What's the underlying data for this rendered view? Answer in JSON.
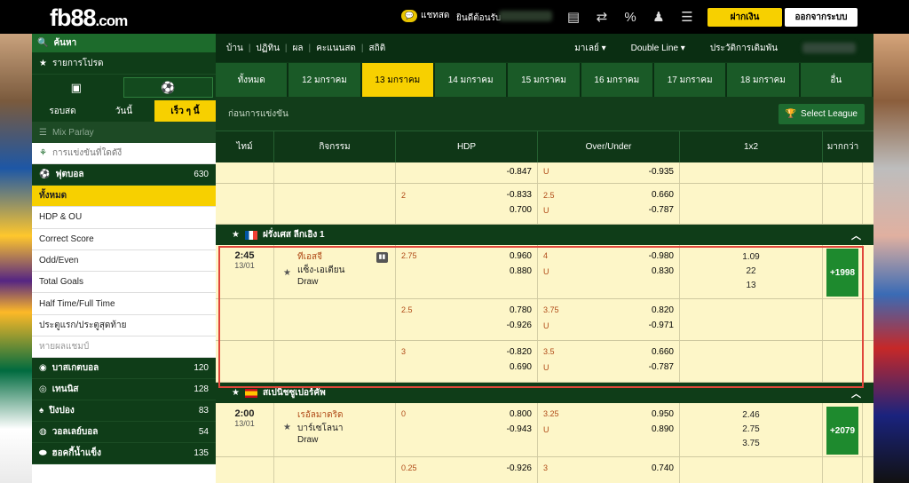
{
  "header": {
    "logo_main": "fb88",
    "logo_tld": ".com",
    "chat_label": "แชทสด",
    "welcome": "ยินดีต้อนรับ",
    "deposit": "ฝากเงิน",
    "logout": "ออกจากระบบ",
    "icons": [
      "bank-icon",
      "transfer-icon",
      "bonus-icon",
      "user-icon",
      "list-icon"
    ]
  },
  "sidebar": {
    "search": "ค้นหา",
    "favorites": "รายการโปรด",
    "tabs": [
      "รอบสด",
      "วันนี้",
      "เร็ว ๆ นี้"
    ],
    "mix_parlay": "Mix Parlay",
    "live_events": "การแข่งขันที่ใดดังี",
    "football": {
      "label": "ฟุตบอล",
      "count": "630"
    },
    "sub_items": [
      "ทั้งหมด",
      "HDP & OU",
      "Correct Score",
      "Odd/Even",
      "Total Goals",
      "Half Time/Full Time",
      "ประตูแรก/ประตูสุดท้าย",
      "หายผลแชมป์"
    ],
    "sports": [
      {
        "label": "บาสเกตบอล",
        "count": "120"
      },
      {
        "label": "เทนนิส",
        "count": "128"
      },
      {
        "label": "ปิงปอง",
        "count": "83"
      },
      {
        "label": "วอลเลย์บอล",
        "count": "54"
      },
      {
        "label": "ฮอคกี้น้ำแข็ง",
        "count": "135"
      }
    ]
  },
  "topnav": {
    "items": [
      "บ้าน",
      "ปฏิทิน",
      "ผล",
      "คะแนนสด",
      "สถิติ"
    ],
    "malay": "มาเลย์",
    "double_line": "Double Line",
    "bet_history": "ประวัติการเดิมพัน"
  },
  "date_tabs": [
    "ทั้งหมด",
    "12 มกราคม",
    "13 มกราคม",
    "14 มกราคม",
    "15 มกราคม",
    "16 มกราคม",
    "17 มกราคม",
    "18 มกราคม",
    "อื่น"
  ],
  "section": {
    "title": "ก่อนการแข่งขัน",
    "select_league": "Select League"
  },
  "columns": {
    "time": "ไทม์",
    "event": "กิจกรรม",
    "hdp": "HDP",
    "ou": "Over/Under",
    "x12": "1x2",
    "more": "มากกว่า"
  },
  "pre_rows": [
    {
      "hdp_line": "",
      "hdp_top": "",
      "hdp_bot": "-0.847",
      "ou_line": "",
      "ou_top": "",
      "ou_u": "U",
      "ou_bot": "-0.935"
    },
    {
      "hdp_line": "2",
      "hdp_top": "-0.833",
      "hdp_bot": "0.700",
      "ou_line": "2.5",
      "ou_top": "0.660",
      "ou_u": "U",
      "ou_bot": "-0.787"
    }
  ],
  "leagues": [
    {
      "name": "ฝรั่งเศส ลีกเอิง 1",
      "match": {
        "time": "2:45",
        "date": "13/01",
        "home": "ทีเอสจี",
        "away": "แซ็ง-เอเตียน",
        "draw": "Draw",
        "x1": "1.09",
        "x2": "22",
        "xd": "13",
        "more": "+1998"
      },
      "rows": [
        {
          "hdp_line": "2.75",
          "hdp_top": "0.960",
          "hdp_bot": "0.880",
          "ou_line": "4",
          "ou_top": "-0.980",
          "ou_u": "U",
          "ou_bot": "0.830"
        },
        {
          "hdp_line": "2.5",
          "hdp_top": "0.780",
          "hdp_bot": "-0.926",
          "ou_line": "3.75",
          "ou_top": "0.820",
          "ou_u": "U",
          "ou_bot": "-0.971"
        },
        {
          "hdp_line": "3",
          "hdp_top": "-0.820",
          "hdp_bot": "0.690",
          "ou_line": "3.5",
          "ou_top": "0.660",
          "ou_u": "U",
          "ou_bot": "-0.787"
        }
      ]
    },
    {
      "name": "สเปนิชซูเปอร์คัพ",
      "match": {
        "time": "2:00",
        "date": "13/01",
        "home": "เรอัลมาดริด",
        "away": "บาร์เซโลนา",
        "draw": "Draw",
        "x1": "2.46",
        "x2": "2.75",
        "xd": "3.75",
        "more": "+2079"
      },
      "rows": [
        {
          "hdp_line": "0",
          "hdp_top": "0.800",
          "hdp_bot": "-0.943",
          "ou_line": "3.25",
          "ou_top": "0.950",
          "ou_u": "U",
          "ou_bot": "0.890"
        },
        {
          "hdp_line": "0.25",
          "hdp_top": "",
          "hdp_bot": "-0.926",
          "ou_line": "3",
          "ou_top": "",
          "ou_u": "",
          "ou_bot": "0.740"
        }
      ]
    }
  ]
}
